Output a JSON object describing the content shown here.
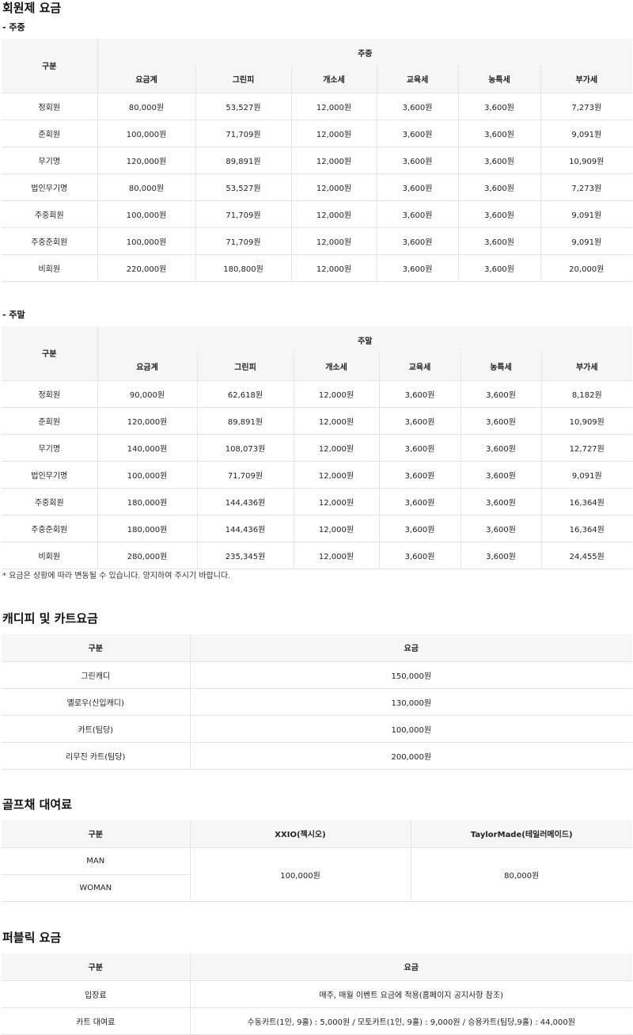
{
  "membership": {
    "title": "회원제 요금",
    "weekday": {
      "label": "- 주중",
      "group_header": "주중",
      "columns": [
        "구분",
        "요금계",
        "그린피",
        "개소세",
        "교육세",
        "농특세",
        "부가세"
      ],
      "rows": [
        [
          "정회원",
          "80,000원",
          "53,527원",
          "12,000원",
          "3,600원",
          "3,600원",
          "7,273원"
        ],
        [
          "준회원",
          "100,000원",
          "71,709원",
          "12,000원",
          "3,600원",
          "3,600원",
          "9,091원"
        ],
        [
          "무기명",
          "120,000원",
          "89,891원",
          "12,000원",
          "3,600원",
          "3,600원",
          "10,909원"
        ],
        [
          "법인무기명",
          "80,000원",
          "53,527원",
          "12,000원",
          "3,600원",
          "3,600원",
          "7,273원"
        ],
        [
          "주중회원",
          "100,000원",
          "71,709원",
          "12,000원",
          "3,600원",
          "3,600원",
          "9,091원"
        ],
        [
          "주중준회원",
          "100,000원",
          "71,709원",
          "12,000원",
          "3,600원",
          "3,600원",
          "9,091원"
        ],
        [
          "비회원",
          "220,000원",
          "180,800원",
          "12,000원",
          "3,600원",
          "3,600원",
          "20,000원"
        ]
      ]
    },
    "weekend": {
      "label": "- 주말",
      "group_header": "주말",
      "columns": [
        "구분",
        "요금계",
        "그린피",
        "개소세",
        "교육세",
        "농특세",
        "부가세"
      ],
      "rows": [
        [
          "정회원",
          "90,000원",
          "62,618원",
          "12,000원",
          "3,600원",
          "3,600원",
          "8,182원"
        ],
        [
          "준회원",
          "120,000원",
          "89,891원",
          "12,000원",
          "3,600원",
          "3,600원",
          "10,909원"
        ],
        [
          "무기명",
          "140,000원",
          "108,073원",
          "12,000원",
          "3,600원",
          "3,600원",
          "12,727원"
        ],
        [
          "법인무기명",
          "100,000원",
          "71,709원",
          "12,000원",
          "3,600원",
          "3,600원",
          "9,091원"
        ],
        [
          "주중회원",
          "180,000원",
          "144,436원",
          "12,000원",
          "3,600원",
          "3,600원",
          "16,364원"
        ],
        [
          "주중준회원",
          "180,000원",
          "144,436원",
          "12,000원",
          "3,600원",
          "3,600원",
          "16,364원"
        ],
        [
          "비회원",
          "280,000원",
          "235,345원",
          "12,000원",
          "3,600원",
          "3,600원",
          "24,455원"
        ]
      ]
    },
    "note": "* 요금은 상황에 따라 변동될 수 있습니다. 양지하여 주시기 바랍니다."
  },
  "caddie": {
    "title": "캐디피 및 카트요금",
    "columns": [
      "구분",
      "요금"
    ],
    "rows": [
      [
        "그린캐디",
        "150,000원"
      ],
      [
        "옐로우(신입캐디)",
        "130,000원"
      ],
      [
        "카트(팀당)",
        "100,000원"
      ],
      [
        "리무진 카트(팀당)",
        "200,000원"
      ]
    ]
  },
  "rental": {
    "title": "골프채 대여료",
    "columns": [
      "구분",
      "XXIO(젝시오)",
      "TaylorMade(테일러메이드)"
    ],
    "rows": [
      "MAN",
      "WOMAN"
    ],
    "prices": [
      "100,000원",
      "80,000원"
    ]
  },
  "public": {
    "title": "퍼블릭 요금",
    "columns": [
      "구분",
      "요금"
    ],
    "rows": [
      [
        "입장료",
        "매주, 매월 이벤트 요금에 적용(홈페이지 공지사항 참조)"
      ],
      [
        "카트 대여료",
        "수동카트(1인, 9홀) : 5,000원 / 모토카트(1인, 9홀) : 9,000원 / 승용카트(팀당,9홀) : 44,000원"
      ]
    ]
  }
}
